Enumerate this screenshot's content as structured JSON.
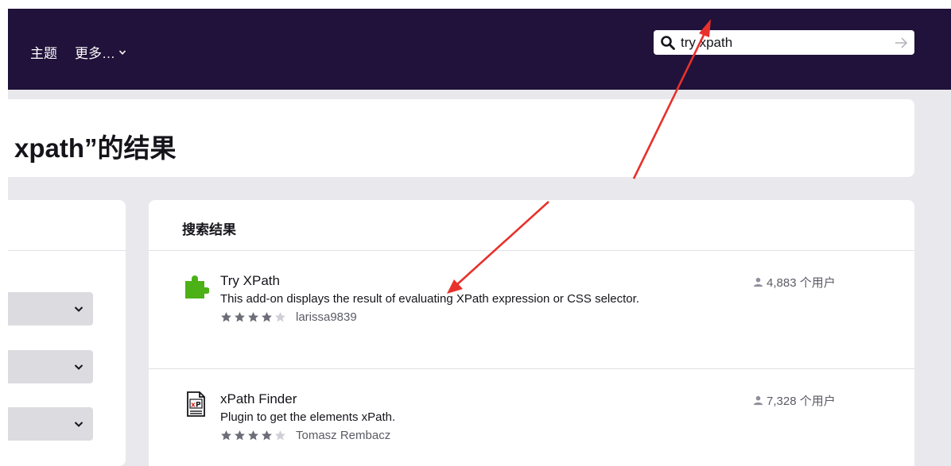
{
  "nav": {
    "themes": "主题",
    "more": "更多…"
  },
  "search": {
    "value": "try xpath",
    "icon": "search-icon"
  },
  "page": {
    "title": "xpath”的结果"
  },
  "results": {
    "header": "搜索结果",
    "items": [
      {
        "title": "Try XPath",
        "description": "This add-on displays the result of evaluating XPath expression or CSS selector.",
        "author": "larissa9839",
        "rating": 4,
        "users": "4,883 个用户",
        "icon": "puzzle-piece-icon"
      },
      {
        "title": "xPath Finder",
        "description": "Plugin to get the elements xPath.",
        "author": "Tomasz Rembacz",
        "rating": 4,
        "users": "7,328 个用户",
        "icon": "xpath-document-icon"
      }
    ]
  },
  "colors": {
    "topbar": "#20123a",
    "annotation": "#e8312b",
    "puzzle": "#4cb116"
  }
}
